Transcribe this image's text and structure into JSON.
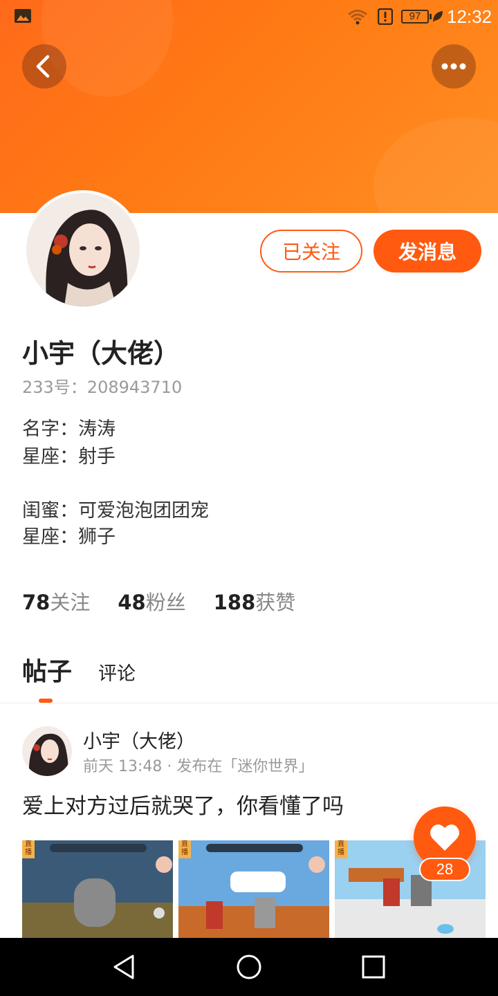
{
  "status_bar": {
    "battery": "97",
    "time": "12:32",
    "icons": [
      "gallery-icon",
      "wifi-icon",
      "alert-icon",
      "battery-icon",
      "leaf-icon"
    ]
  },
  "header": {
    "back_icon": "chevron-left-icon",
    "more_icon": "more-horizontal-icon",
    "accent": "#ff6a1a"
  },
  "profile": {
    "follow_label": "已关注",
    "message_label": "发消息",
    "username": "小宇（大佬）",
    "id_text": "233号：208943710",
    "bio": [
      "名字：涛涛",
      "星座：射手",
      "",
      "闺蜜：可爱泡泡团团宠",
      "星座：狮子"
    ],
    "stats": [
      {
        "num": "78",
        "label": "关注"
      },
      {
        "num": "48",
        "label": "粉丝"
      },
      {
        "num": "188",
        "label": "获赞"
      }
    ]
  },
  "tabs": [
    {
      "label": "帖子",
      "active": true
    },
    {
      "label": "评论",
      "active": false
    }
  ],
  "post": {
    "author": "小宇（大佬）",
    "meta": "前天 13:48 · 发布在「迷你世界」",
    "text": "爱上对方过后就哭了，你看懂了吗",
    "thumb_badge": "直播"
  },
  "like": {
    "icon": "heart-icon",
    "count": "28"
  },
  "nav": {
    "icons": [
      "back-triangle-icon",
      "home-circle-icon",
      "recents-square-icon"
    ]
  }
}
